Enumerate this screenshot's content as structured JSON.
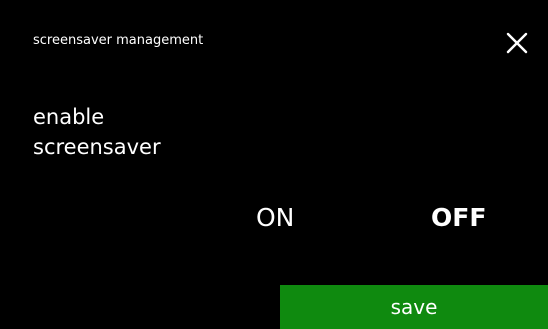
{
  "header": {
    "title": "screensaver management",
    "close_icon": "close-icon"
  },
  "setting": {
    "label_line1": "enable",
    "label_line2": "screensaver"
  },
  "toggle": {
    "on_label": "ON",
    "off_label": "OFF",
    "selected": "OFF"
  },
  "footer": {
    "save_label": "save"
  },
  "colors": {
    "background": "#000000",
    "text": "#ffffff",
    "save_button": "#0f8a0f"
  }
}
